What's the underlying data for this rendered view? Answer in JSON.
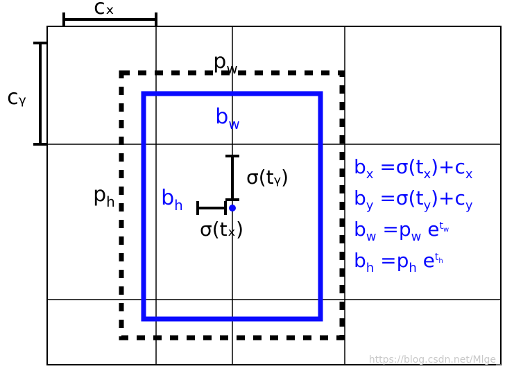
{
  "labels": {
    "cx": "cₓ",
    "cy": "cᵧ",
    "pw": "p_w",
    "ph": "p_h",
    "bw": "b_w",
    "bh": "b_h",
    "sigma_tx": "σ(tₓ)",
    "sigma_ty": "σ(tᵧ)"
  },
  "equations": {
    "e1_lhs": "bₓ",
    "e1_rhs_a": "=σ(tₓ)+c",
    "e1_rhs_b": "ₓ",
    "e2_lhs": "bᵧ",
    "e2_rhs_a": "=σ(tᵧ)+c",
    "e2_rhs_b": "ᵧ",
    "e3_lhs": "b_w",
    "e3_rhs_a": "=p_w",
    "e3_rhs_b": "e",
    "e3_rhs_c": "t_w",
    "e4_lhs": "b_h",
    "e4_rhs_a": "=p_h",
    "e4_rhs_b": "e",
    "e4_rhs_c": "t_h"
  },
  "colors": {
    "blue": "#0a0aff",
    "black": "#000000",
    "grid": "#000000"
  },
  "watermark": "https://blog.csdn.net/Mlge_"
}
